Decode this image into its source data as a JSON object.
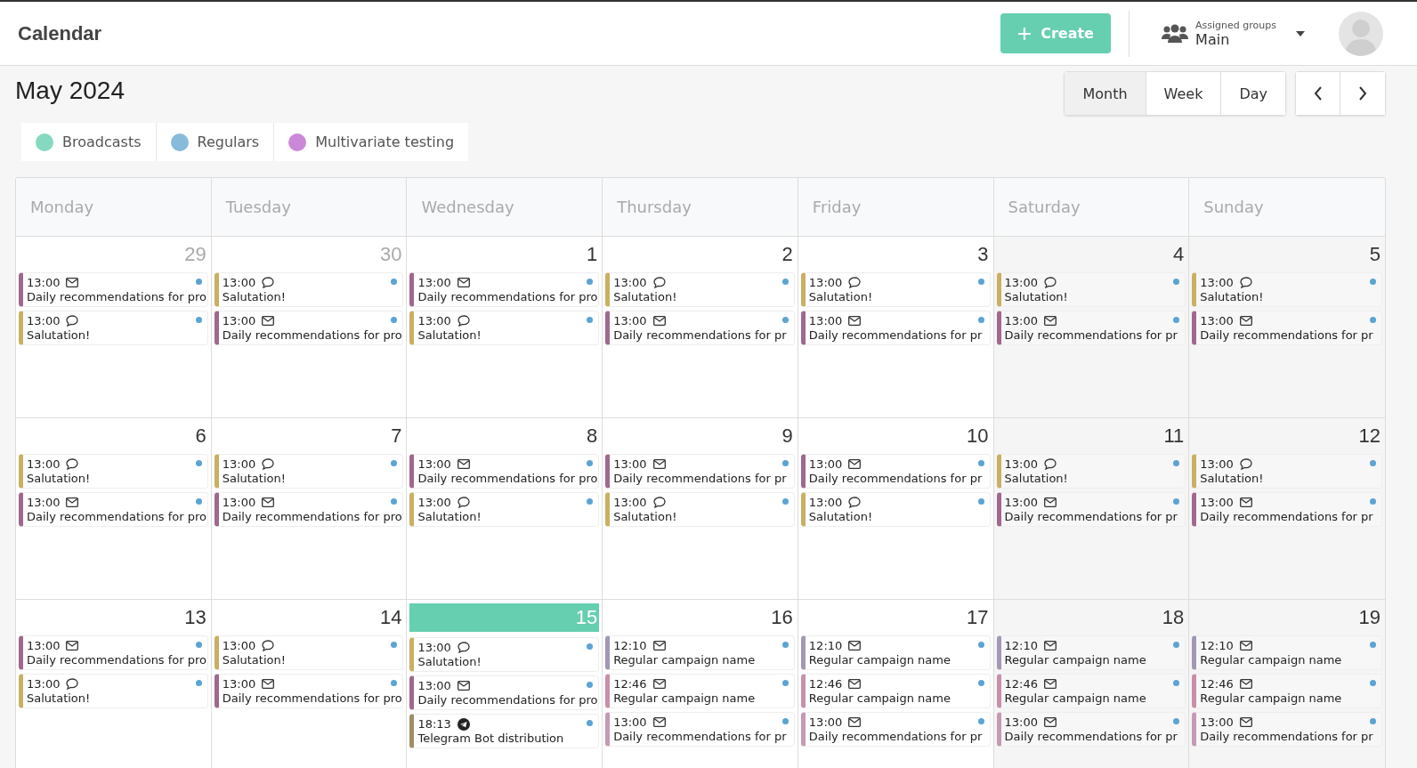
{
  "app_bar": {
    "title": "Calendar",
    "create_button": "Create",
    "groups": {
      "label": "Assigned groups",
      "value": "Main"
    }
  },
  "period": "May 2024",
  "views": [
    {
      "label": "Month",
      "selected": true
    },
    {
      "label": "Week",
      "selected": false
    },
    {
      "label": "Day",
      "selected": false
    }
  ],
  "legend": [
    {
      "label": "Broadcasts",
      "color": "#84d9c0"
    },
    {
      "label": "Regulars",
      "color": "#87bbd9"
    },
    {
      "label": "Multivariate testing",
      "color": "#cc88d8"
    }
  ],
  "weekdays": [
    "Monday",
    "Tuesday",
    "Wednesday",
    "Thursday",
    "Friday",
    "Saturday",
    "Sunday"
  ],
  "weeks": [
    [
      {
        "date": "29",
        "muted": true,
        "today": false,
        "events": [
          {
            "time": "13:00",
            "kind": "email",
            "title": "Daily recommendations for pro",
            "color": "#a0688f"
          },
          {
            "time": "13:00",
            "kind": "chat",
            "title": "Salutation!",
            "color": "#c9b062"
          }
        ]
      },
      {
        "date": "30",
        "muted": true,
        "today": false,
        "events": [
          {
            "time": "13:00",
            "kind": "chat",
            "title": "Salutation!",
            "color": "#c9b062"
          },
          {
            "time": "13:00",
            "kind": "email",
            "title": "Daily recommendations for pro",
            "color": "#a0688f"
          }
        ]
      },
      {
        "date": "1",
        "muted": false,
        "today": false,
        "events": [
          {
            "time": "13:00",
            "kind": "email",
            "title": "Daily recommendations for pro",
            "color": "#a0688f"
          },
          {
            "time": "13:00",
            "kind": "chat",
            "title": "Salutation!",
            "color": "#c9b062"
          }
        ]
      },
      {
        "date": "2",
        "muted": false,
        "today": false,
        "events": [
          {
            "time": "13:00",
            "kind": "chat",
            "title": "Salutation!",
            "color": "#c9b062"
          },
          {
            "time": "13:00",
            "kind": "email",
            "title": "Daily recommendations for pr",
            "color": "#a0688f"
          }
        ]
      },
      {
        "date": "3",
        "muted": false,
        "today": false,
        "events": [
          {
            "time": "13:00",
            "kind": "chat",
            "title": "Salutation!",
            "color": "#c9b062"
          },
          {
            "time": "13:00",
            "kind": "email",
            "title": "Daily recommendations for pr",
            "color": "#a0688f"
          }
        ]
      },
      {
        "date": "4",
        "muted": false,
        "today": false,
        "events": [
          {
            "time": "13:00",
            "kind": "chat",
            "title": "Salutation!",
            "color": "#c9b062"
          },
          {
            "time": "13:00",
            "kind": "email",
            "title": "Daily recommendations for pr",
            "color": "#a0688f"
          }
        ]
      },
      {
        "date": "5",
        "muted": false,
        "today": false,
        "events": [
          {
            "time": "13:00",
            "kind": "chat",
            "title": "Salutation!",
            "color": "#c9b062"
          },
          {
            "time": "13:00",
            "kind": "email",
            "title": "Daily recommendations for pr",
            "color": "#a0688f"
          }
        ]
      }
    ],
    [
      {
        "date": "6",
        "muted": false,
        "today": false,
        "events": [
          {
            "time": "13:00",
            "kind": "chat",
            "title": "Salutation!",
            "color": "#c9b062"
          },
          {
            "time": "13:00",
            "kind": "email",
            "title": "Daily recommendations for pro",
            "color": "#a0688f"
          }
        ]
      },
      {
        "date": "7",
        "muted": false,
        "today": false,
        "events": [
          {
            "time": "13:00",
            "kind": "chat",
            "title": "Salutation!",
            "color": "#c9b062"
          },
          {
            "time": "13:00",
            "kind": "email",
            "title": "Daily recommendations for pro",
            "color": "#a0688f"
          }
        ]
      },
      {
        "date": "8",
        "muted": false,
        "today": false,
        "events": [
          {
            "time": "13:00",
            "kind": "email",
            "title": "Daily recommendations for pro",
            "color": "#a0688f"
          },
          {
            "time": "13:00",
            "kind": "chat",
            "title": "Salutation!",
            "color": "#c9b062"
          }
        ]
      },
      {
        "date": "9",
        "muted": false,
        "today": false,
        "events": [
          {
            "time": "13:00",
            "kind": "email",
            "title": "Daily recommendations for pr",
            "color": "#a0688f"
          },
          {
            "time": "13:00",
            "kind": "chat",
            "title": "Salutation!",
            "color": "#c9b062"
          }
        ]
      },
      {
        "date": "10",
        "muted": false,
        "today": false,
        "events": [
          {
            "time": "13:00",
            "kind": "email",
            "title": "Daily recommendations for pr",
            "color": "#a0688f"
          },
          {
            "time": "13:00",
            "kind": "chat",
            "title": "Salutation!",
            "color": "#c9b062"
          }
        ]
      },
      {
        "date": "11",
        "muted": false,
        "today": false,
        "events": [
          {
            "time": "13:00",
            "kind": "chat",
            "title": "Salutation!",
            "color": "#c9b062"
          },
          {
            "time": "13:00",
            "kind": "email",
            "title": "Daily recommendations for pr",
            "color": "#a0688f"
          }
        ]
      },
      {
        "date": "12",
        "muted": false,
        "today": false,
        "events": [
          {
            "time": "13:00",
            "kind": "chat",
            "title": "Salutation!",
            "color": "#c9b062"
          },
          {
            "time": "13:00",
            "kind": "email",
            "title": "Daily recommendations for pr",
            "color": "#a0688f"
          }
        ]
      }
    ],
    [
      {
        "date": "13",
        "muted": false,
        "today": false,
        "events": [
          {
            "time": "13:00",
            "kind": "email",
            "title": "Daily recommendations for pro",
            "color": "#a0688f"
          },
          {
            "time": "13:00",
            "kind": "chat",
            "title": "Salutation!",
            "color": "#c9b062"
          }
        ]
      },
      {
        "date": "14",
        "muted": false,
        "today": false,
        "events": [
          {
            "time": "13:00",
            "kind": "chat",
            "title": "Salutation!",
            "color": "#c9b062"
          },
          {
            "time": "13:00",
            "kind": "email",
            "title": "Daily recommendations for pro",
            "color": "#a0688f"
          }
        ]
      },
      {
        "date": "15",
        "muted": false,
        "today": true,
        "events": [
          {
            "time": "13:00",
            "kind": "chat",
            "title": "Salutation!",
            "color": "#c9b062"
          },
          {
            "time": "13:00",
            "kind": "email",
            "title": "Daily recommendations for pro",
            "color": "#a0688f"
          },
          {
            "time": "18:13",
            "kind": "telegram",
            "title": "Telegram Bot distribution",
            "color": "#a08c66"
          }
        ]
      },
      {
        "date": "16",
        "muted": false,
        "today": false,
        "events": [
          {
            "time": "12:10",
            "kind": "email",
            "title": "Regular campaign name",
            "color": "#a397b5"
          },
          {
            "time": "12:46",
            "kind": "email",
            "title": "Regular campaign name",
            "color": "#c88fab"
          },
          {
            "time": "13:00",
            "kind": "email",
            "title": "Daily recommendations for pr",
            "color": "#c49ab5"
          }
        ]
      },
      {
        "date": "17",
        "muted": false,
        "today": false,
        "events": [
          {
            "time": "12:10",
            "kind": "email",
            "title": "Regular campaign name",
            "color": "#a397b5"
          },
          {
            "time": "12:46",
            "kind": "email",
            "title": "Regular campaign name",
            "color": "#c88fab"
          },
          {
            "time": "13:00",
            "kind": "email",
            "title": "Daily recommendations for pr",
            "color": "#c49ab5"
          }
        ]
      },
      {
        "date": "18",
        "muted": false,
        "today": false,
        "events": [
          {
            "time": "12:10",
            "kind": "email",
            "title": "Regular campaign name",
            "color": "#a397b5"
          },
          {
            "time": "12:46",
            "kind": "email",
            "title": "Regular campaign name",
            "color": "#c88fab"
          },
          {
            "time": "13:00",
            "kind": "email",
            "title": "Daily recommendations for pr",
            "color": "#c49ab5"
          }
        ]
      },
      {
        "date": "19",
        "muted": false,
        "today": false,
        "events": [
          {
            "time": "12:10",
            "kind": "email",
            "title": "Regular campaign name",
            "color": "#a397b5"
          },
          {
            "time": "12:46",
            "kind": "email",
            "title": "Regular campaign name",
            "color": "#c88fab"
          },
          {
            "time": "13:00",
            "kind": "email",
            "title": "Daily recommendations for pr",
            "color": "#c49ab5"
          }
        ]
      }
    ]
  ]
}
